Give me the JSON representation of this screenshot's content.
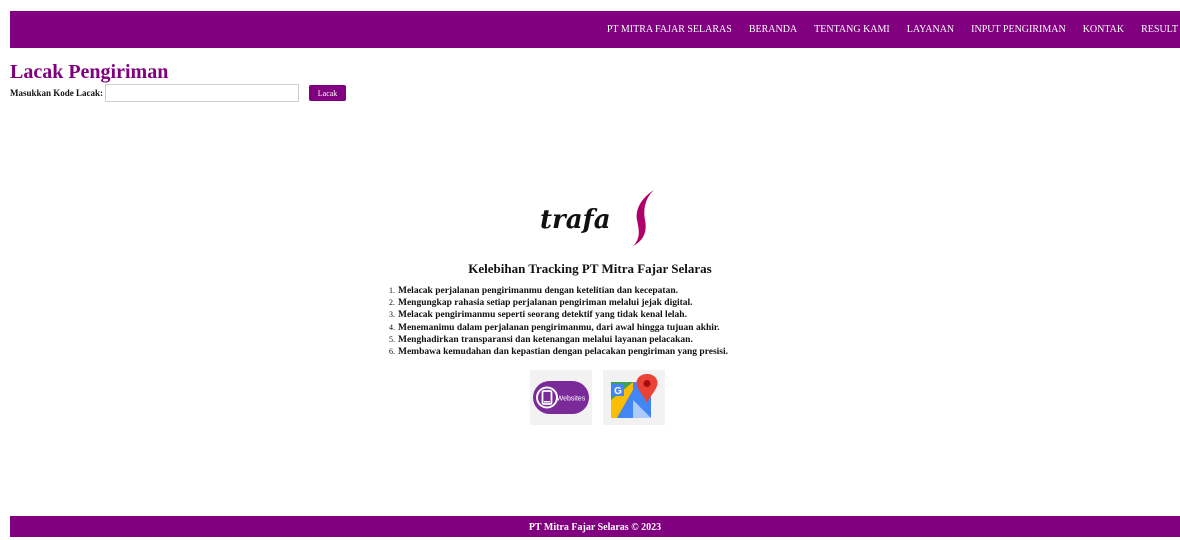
{
  "nav": {
    "items": [
      "PT MITRA FAJAR SELARAS",
      "BERANDA",
      "TENTANG KAMI",
      "LAYANAN",
      "INPUT PENGIRIMAN",
      "KONTAK",
      "RESULT"
    ]
  },
  "tracking": {
    "title": "Lacak Pengiriman",
    "label": "Masukkan Kode Lacak:",
    "input_value": "",
    "button": "Lacak"
  },
  "logo_text": "trafa",
  "advantages": {
    "title": "Kelebihan Tracking PT Mitra Fajar Selaras",
    "items": [
      "Melacak perjalanan pengirimanmu dengan ketelitian dan kecepatan.",
      "Mengungkap rahasia setiap perjalanan pengiriman melalui jejak digital.",
      "Melacak pengirimanmu seperti seorang detektif yang tidak kenal lelah.",
      "Menemanimu dalam perjalanan pengirimanmu, dari awal hingga tujuan akhir.",
      "Menghadirkan transparansi dan ketenangan melalui layanan pelacakan.",
      "Membawa kemudahan dan kepastian dengan pelacakan pengiriman yang presisi."
    ]
  },
  "badges": {
    "websites_label": "Websites"
  },
  "icons": [
    "websites-icon",
    "google-maps-icon"
  ],
  "colors": {
    "brand": "#800080",
    "logo_accent": "#b0006a"
  },
  "footer": {
    "text": "PT Mitra Fajar Selaras © 2023"
  }
}
